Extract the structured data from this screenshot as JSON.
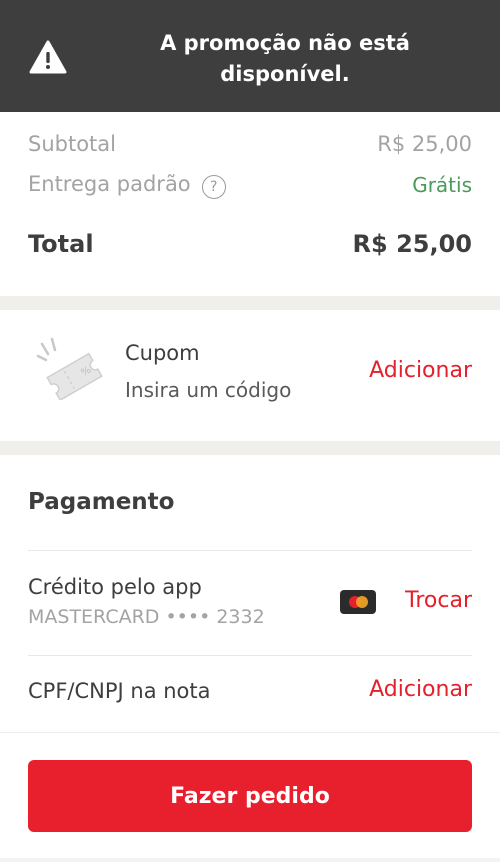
{
  "toast": {
    "icon": "warning-icon",
    "message_line1": "A promoção não está",
    "message_line2": "disponível."
  },
  "summary": {
    "subtotal_label": "Subtotal",
    "subtotal_value": "R$ 25,00",
    "delivery_label": "Entrega padrão",
    "delivery_help_icon": "?",
    "delivery_value": "Grátis",
    "total_label": "Total",
    "total_value": "R$ 25,00"
  },
  "coupon": {
    "icon": "coupon-ticket-icon",
    "title": "Cupom",
    "subtitle": "Insira um código",
    "action": "Adicionar"
  },
  "payment": {
    "section_title": "Pagamento",
    "method_label": "Crédito pelo app",
    "card_label": "MASTERCARD •••• 2332",
    "card_icon": "mastercard-icon",
    "change_action": "Trocar",
    "cpf_label": "CPF/CNPJ na nota",
    "cpf_action": "Adicionar"
  },
  "footer": {
    "order_button": "Fazer pedido"
  },
  "colors": {
    "accent_red": "#e81f2d",
    "success_green": "#4a9a5a",
    "toast_bg": "#3f3e3e",
    "band_bg": "#f1efe9"
  }
}
